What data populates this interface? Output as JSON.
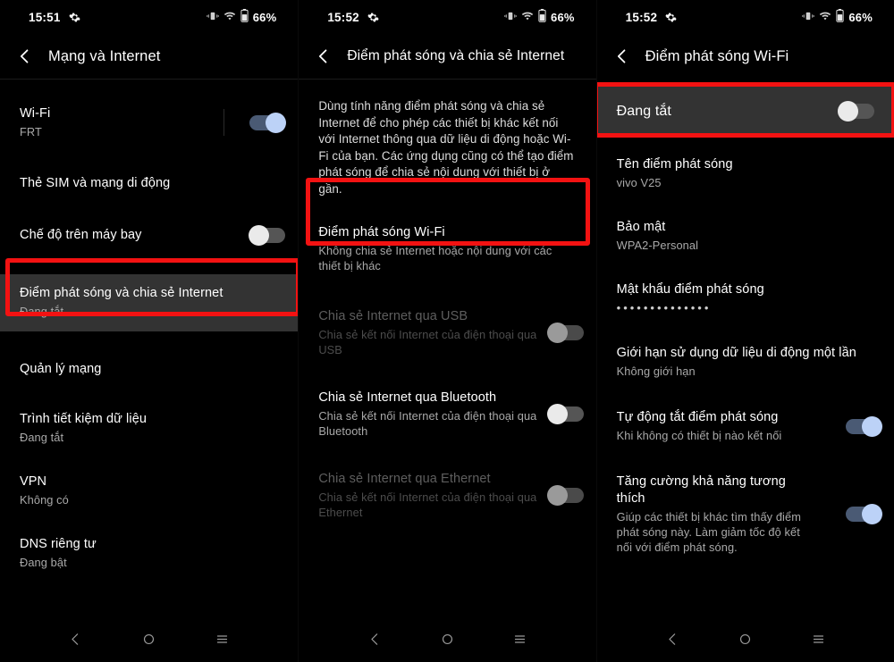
{
  "panels": [
    {
      "status": {
        "time": "15:51",
        "battery": "66%",
        "icons": [
          "vibrate-icon",
          "wifi-icon",
          "battery-icon"
        ]
      },
      "header": {
        "title": "Mạng và Internet",
        "back": "back-chevron"
      },
      "items": [
        {
          "title": "Wi-Fi",
          "sub": "FRT",
          "toggle": "on",
          "divider": true
        },
        {
          "title": "Thẻ SIM và mạng di động",
          "sub": ""
        },
        {
          "title": "Chế độ trên máy bay",
          "sub": "",
          "toggle": "off"
        },
        {
          "title": "Điểm phát sóng và chia sẻ Internet",
          "sub": "Đang tắt",
          "highlight": true
        },
        {
          "title": "Quản lý mạng",
          "sub": ""
        },
        {
          "title": "Trình tiết kiệm dữ liệu",
          "sub": "Đang tắt"
        },
        {
          "title": "VPN",
          "sub": "Không có"
        },
        {
          "title": "DNS riêng tư",
          "sub": "Đang bật"
        }
      ],
      "nav": [
        "back-icon",
        "home-icon",
        "recents-icon"
      ]
    },
    {
      "status": {
        "time": "15:52",
        "battery": "66%",
        "icons": [
          "vibrate-icon",
          "wifi-icon",
          "battery-icon"
        ]
      },
      "header": {
        "title": "Điểm phát sóng và chia sẻ Internet",
        "back": "back-chevron"
      },
      "paragraph": "Dùng tính năng điểm phát sóng và chia sẻ Internet để cho phép các thiết bị khác kết nối với Internet thông qua dữ liệu di động hoặc Wi-Fi của bạn. Các ứng dụng cũng có thể tạo điểm phát sóng để chia sẻ nội dung với thiết bị ở gần.",
      "items": [
        {
          "title": "Điểm phát sóng Wi-Fi",
          "sub": "Không chia sẻ Internet hoặc nội dung với các thiết bị khác",
          "highlight": true
        },
        {
          "title": "Chia sẻ Internet qua USB",
          "sub": "Chia sẻ kết nối Internet của điện thoại qua USB",
          "toggle": "off",
          "disabled": true
        },
        {
          "title": "Chia sẻ Internet qua Bluetooth",
          "sub": "Chia sẻ kết nối Internet của điện thoại qua Bluetooth",
          "toggle": "off"
        },
        {
          "title": "Chia sẻ Internet qua Ethernet",
          "sub": "Chia sẻ kết nối Internet của điện thoại qua Ethernet",
          "toggle": "off",
          "disabled": true
        }
      ],
      "nav": [
        "back-icon",
        "home-icon",
        "recents-icon"
      ]
    },
    {
      "status": {
        "time": "15:52",
        "battery": "66%",
        "icons": [
          "vibrate-icon",
          "wifi-icon",
          "battery-icon"
        ]
      },
      "header": {
        "title": "Điểm phát sóng Wi-Fi",
        "back": "back-chevron"
      },
      "items": [
        {
          "title": "Đang tắt",
          "sub": "",
          "toggle": "off",
          "highlight": true,
          "bigrow": true
        },
        {
          "title": "Tên điểm phát sóng",
          "sub": "vivo V25"
        },
        {
          "title": "Bảo mật",
          "sub": "WPA2-Personal"
        },
        {
          "title": "Mật khẩu điểm phát sóng",
          "sub": "••••••••••••••",
          "dots": true
        },
        {
          "title": "Giới hạn sử dụng dữ liệu di động một lần",
          "sub": "Không giới hạn"
        },
        {
          "title": "Tự động tắt điểm phát sóng",
          "sub": "Khi không có thiết bị nào kết nối",
          "toggle": "on"
        },
        {
          "title": "Tăng cường khả năng tương thích",
          "sub": "Giúp các thiết bị khác tìm thấy điểm phát sóng này. Làm giảm tốc độ kết nối với điểm phát sóng.",
          "toggle": "on"
        }
      ],
      "nav": [
        "back-icon",
        "home-icon",
        "recents-icon"
      ]
    }
  ],
  "colors": {
    "highlight_border": "#f31212",
    "toggle_on_track": "#4a5a74",
    "toggle_on_knob": "#bcd2f7",
    "background": "#000000",
    "row_highlight_bg": "#333333"
  }
}
